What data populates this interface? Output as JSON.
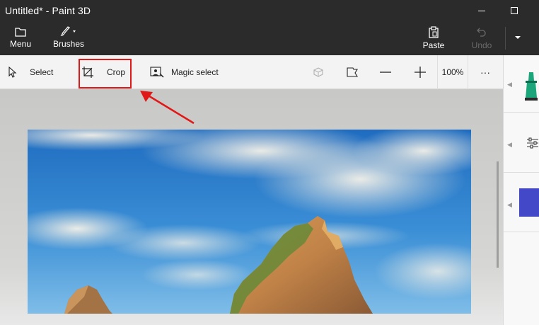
{
  "window": {
    "title": "Untitled* - Paint 3D"
  },
  "commandbar": {
    "menu_label": "Menu",
    "brushes_label": "Brushes",
    "paste_label": "Paste",
    "undo_label": "Undo"
  },
  "toolbar": {
    "select_label": "Select",
    "crop_label": "Crop",
    "magic_select_label": "Magic select",
    "zoom_value": "100%",
    "more_label": "···"
  },
  "icons": {
    "menu": "folder-icon",
    "brushes": "brush-icon",
    "paste": "clipboard-icon",
    "undo": "undo-icon",
    "select": "cursor-icon",
    "crop": "crop-icon",
    "magic_select": "magic-select-icon",
    "view3d": "3d-view-icon",
    "view": "view-flag-icon",
    "zoom_out": "minus-icon",
    "zoom_in": "plus-icon"
  },
  "colors": {
    "chrome": "#2b2b2b",
    "toolbar": "#f3f3f3",
    "highlight": "#e01818",
    "selected_color": "#4248c8",
    "marker": "#1aa67a"
  }
}
